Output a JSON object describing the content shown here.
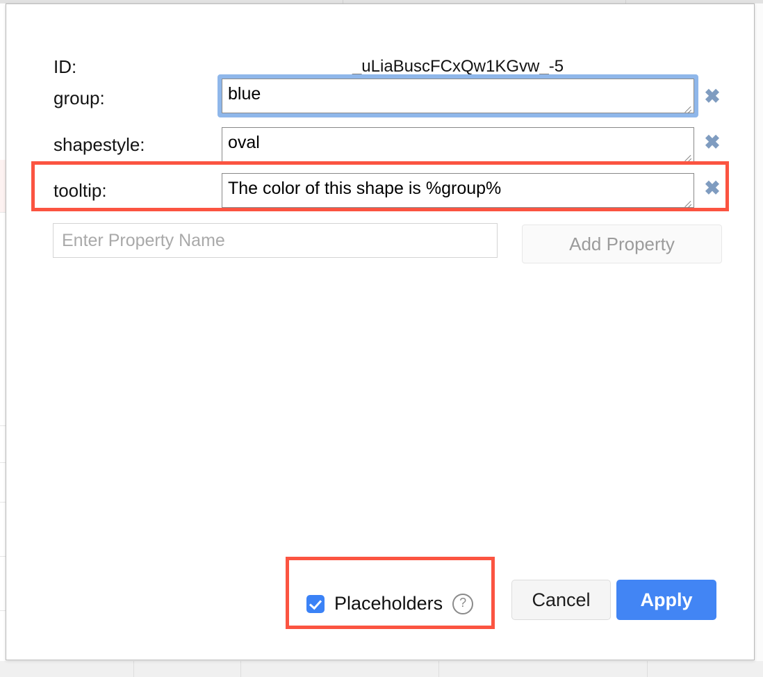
{
  "dialog": {
    "properties": [
      {
        "label": "ID:",
        "value": "_uLiaBuscFCxQw1KGvw_-5",
        "type": "static",
        "deletable": false,
        "focused": false,
        "highlighted": false
      },
      {
        "label": "group:",
        "value": "blue",
        "type": "textarea",
        "deletable": true,
        "focused": true,
        "highlighted": false
      },
      {
        "label": "shapestyle:",
        "value": "oval",
        "type": "textarea",
        "deletable": true,
        "focused": false,
        "highlighted": false
      },
      {
        "label": "tooltip:",
        "value": "The color of this shape is %group%",
        "type": "textarea",
        "deletable": true,
        "focused": false,
        "highlighted": true
      }
    ],
    "delete_icon": "✖",
    "add_property": {
      "input_placeholder": "Enter Property Name",
      "input_value": "",
      "button_label": "Add Property"
    },
    "footer": {
      "placeholders_label": "Placeholders",
      "placeholders_checked": true,
      "help_icon": "?",
      "cancel_label": "Cancel",
      "apply_label": "Apply"
    }
  },
  "colors": {
    "highlight_red": "#fb5441",
    "apply_blue": "#4285f4",
    "checkbox_blue": "#3b82f6",
    "focus_ring_blue": "#8fb7ea",
    "delete_icon_blue": "#7f9cc0"
  }
}
